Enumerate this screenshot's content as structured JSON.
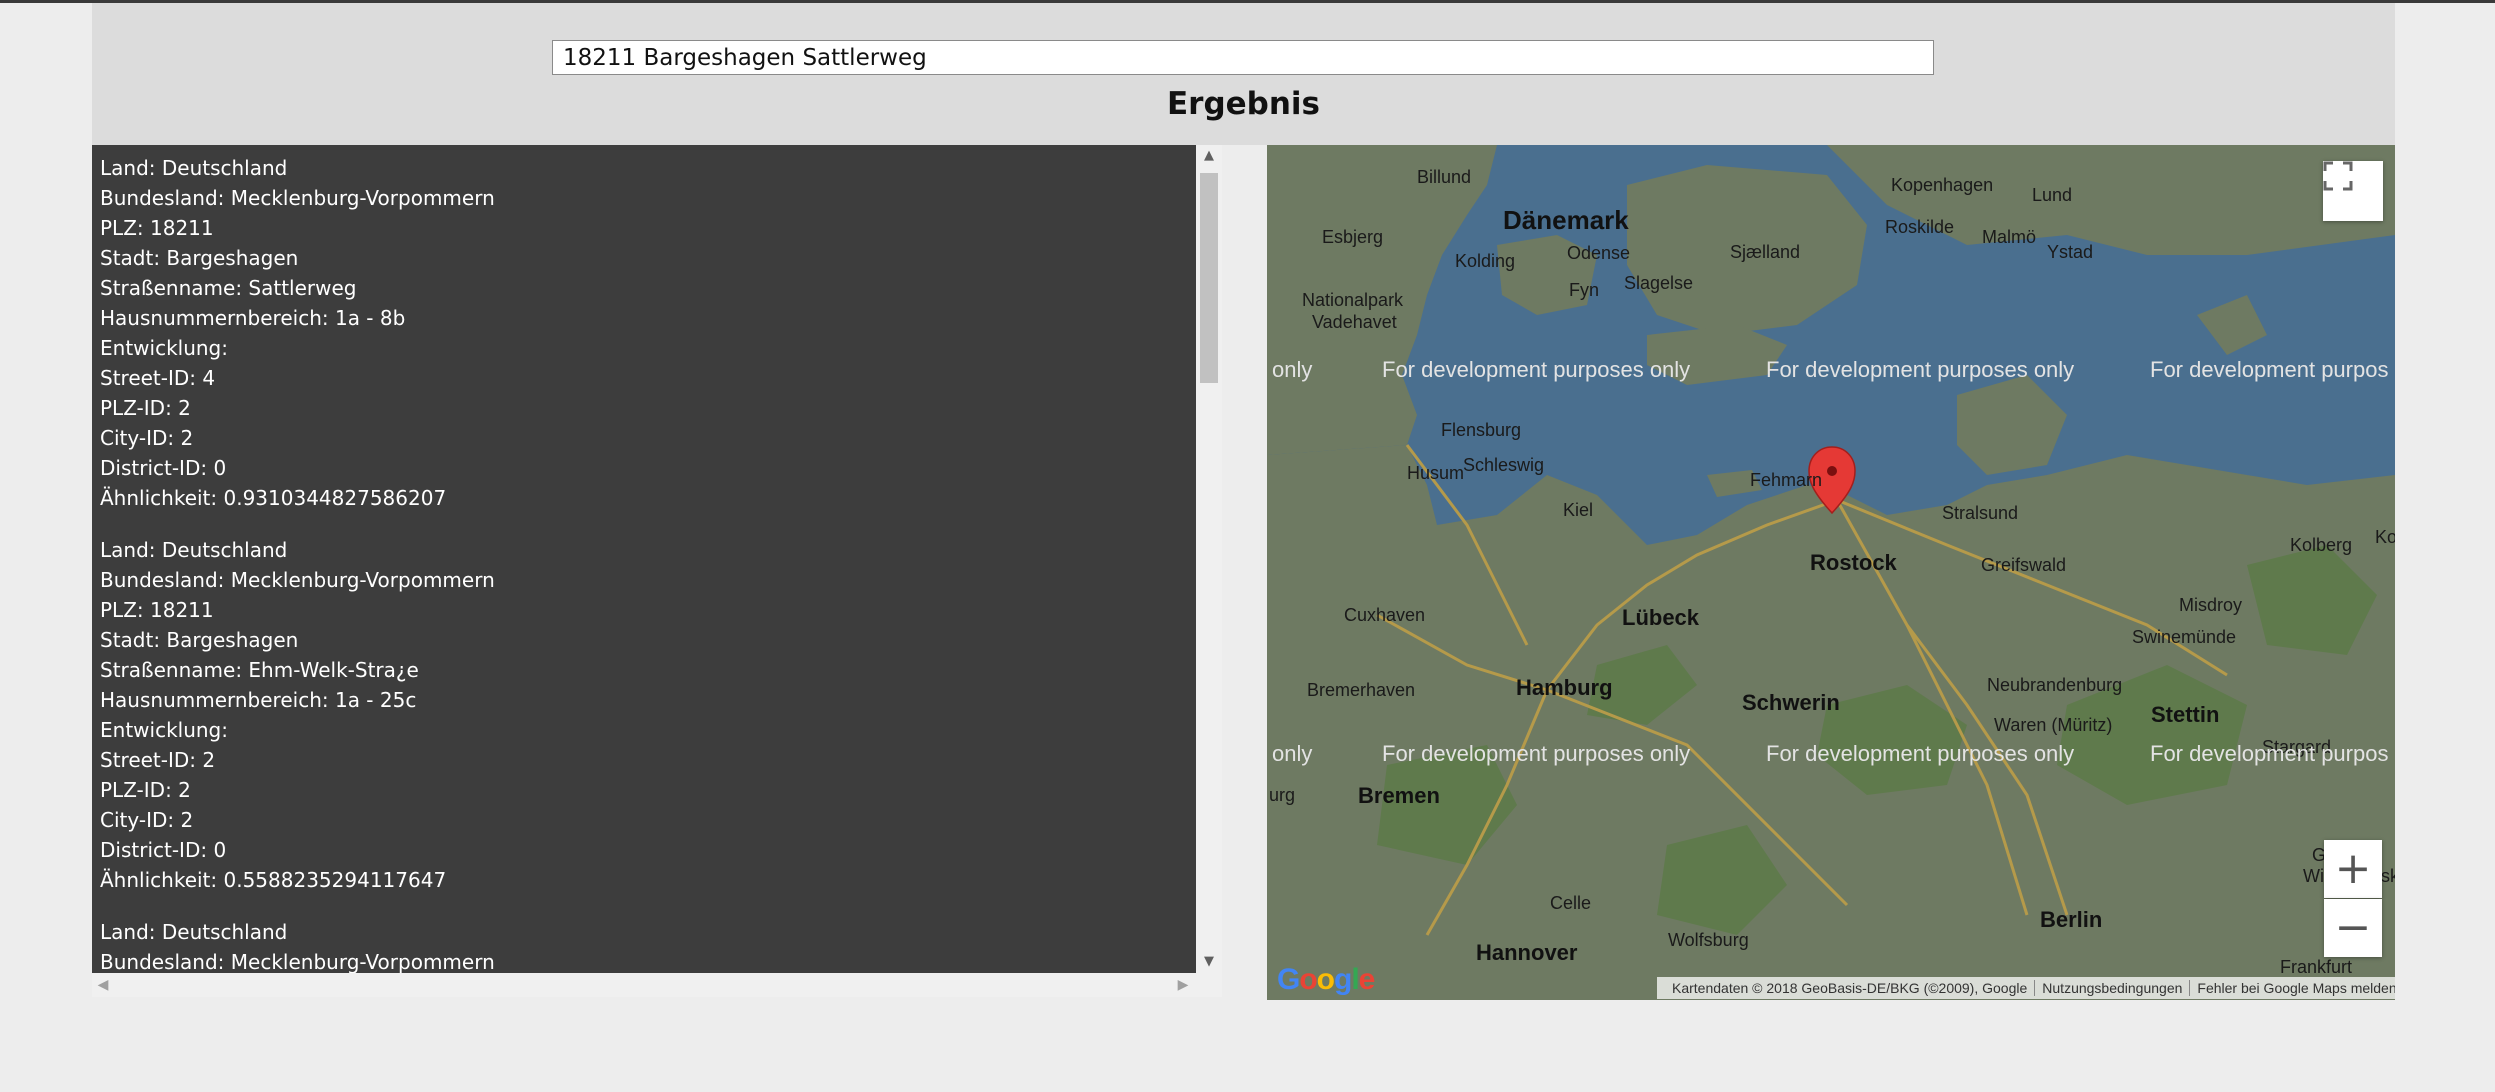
{
  "search": {
    "value": "18211 Bargeshagen Sattlerweg"
  },
  "heading": "Ergebnis",
  "results": [
    {
      "lines": [
        "Land: Deutschland",
        "Bundesland: Mecklenburg-Vorpommern",
        "PLZ: 18211",
        "Stadt: Bargeshagen",
        "Straßenname: Sattlerweg",
        "Hausnummernbereich: 1a - 8b",
        "Entwicklung:",
        "Street-ID: 4",
        "PLZ-ID: 2",
        "City-ID: 2",
        "District-ID: 0",
        "Ähnlichkeit: 0.9310344827586207"
      ]
    },
    {
      "lines": [
        "Land: Deutschland",
        "Bundesland: Mecklenburg-Vorpommern",
        "PLZ: 18211",
        "Stadt: Bargeshagen",
        "Straßenname: Ehm-Welk-Stra¿e",
        "Hausnummernbereich: 1a - 25c",
        "Entwicklung:",
        "Street-ID: 2",
        "PLZ-ID: 2",
        "City-ID: 2",
        "District-ID: 0",
        "Ähnlichkeit: 0.5588235294117647"
      ]
    },
    {
      "lines": [
        "Land: Deutschland",
        "Bundesland: Mecklenburg-Vorpommern"
      ]
    }
  ],
  "map": {
    "labels": {
      "country": "Dänemark",
      "kopenhagen": "Kopenhagen",
      "lund": "Lund",
      "malmo": "Malmö",
      "ystad": "Ystad",
      "roskilde": "Roskilde",
      "billund": "Billund",
      "esbjerg": "Esbjerg",
      "kolding": "Kolding",
      "odense": "Odense",
      "sjaelland": "Sjælland",
      "slagelse": "Slagelse",
      "fyn": "Fyn",
      "nationalpark1": "Nationalpark",
      "nationalpark2": "Vadehavet",
      "flensburg": "Flensburg",
      "husum": "Husum",
      "schleswig": "Schleswig",
      "fehmarn": "Fehmarn",
      "kiel": "Kiel",
      "stralsund": "Stralsund",
      "kolberg": "Kolberg",
      "greifswald": "Greifswald",
      "rostock": "Rostock",
      "cuxhaven": "Cuxhaven",
      "lubeck": "Lübeck",
      "misdroy": "Misdroy",
      "swinemunde": "Swinemünde",
      "bremerhaven": "Bremerhaven",
      "hamburg": "Hamburg",
      "schwerin": "Schwerin",
      "neubrandenburg": "Neubrandenburg",
      "stettin": "Stettin",
      "waren": "Waren (Müritz)",
      "stargard": "Stargard",
      "bremen": "Bremen",
      "celle": "Celle",
      "hannover": "Hannover",
      "wolfsburg": "Wolfsburg",
      "berlin": "Berlin",
      "gorzow1": "Gorzów",
      "gorzow2": "Wielkopolski",
      "frankfurt": "Frankfurt",
      "ko": "Ko",
      "urg": "urg"
    },
    "watermark_text": "For development purposes only",
    "watermark_left_fragment": "only",
    "watermark_right_fragment": "For development purpos",
    "copyright": "Kartendaten © 2018 GeoBasis-DE/BKG (©2009), Google",
    "terms": "Nutzungsbedingungen",
    "report": "Fehler bei Google Maps melden",
    "google": "Google",
    "zoom_in": "+",
    "zoom_out": "−",
    "water_color": "#4a6f8f",
    "land_color": "#6e7a62",
    "marker_color": "#e53935"
  },
  "scrollbars": {
    "up": "▲",
    "down": "▼",
    "left": "◀",
    "right": "▶"
  }
}
